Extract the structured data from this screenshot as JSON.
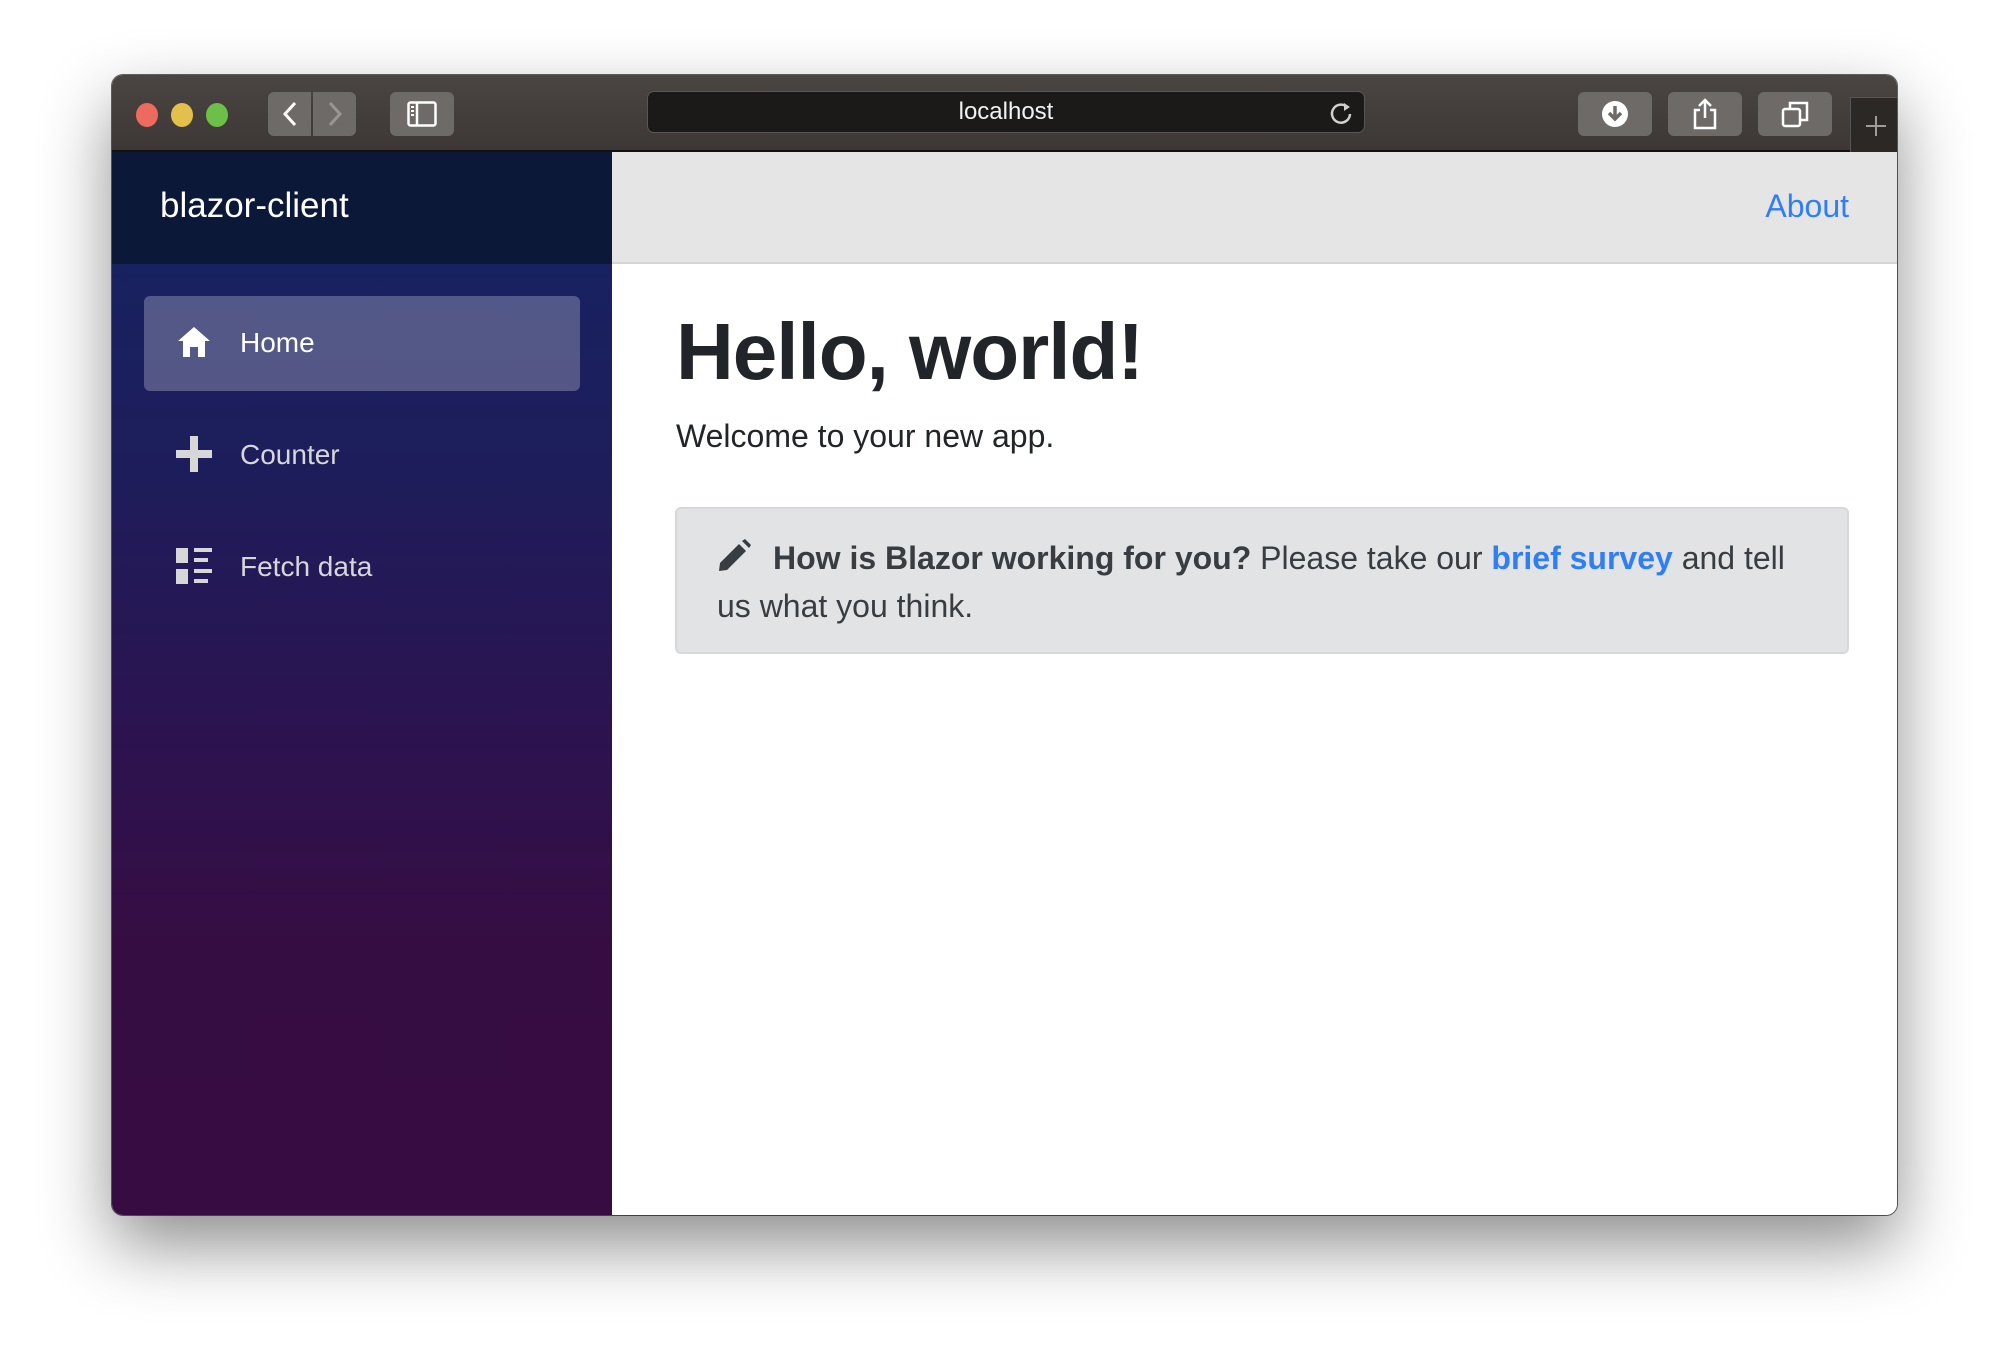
{
  "browser": {
    "url": "localhost",
    "traffic_lights": {
      "close": "#ed6a5e",
      "minimize": "#e2c04b",
      "zoom": "#6cbf47"
    },
    "buttons": [
      "back",
      "forward",
      "sidebar",
      "downloads",
      "share",
      "tabs",
      "new-tab"
    ]
  },
  "sidebar": {
    "brand": "blazor-client",
    "items": [
      {
        "label": "Home",
        "icon": "home-icon",
        "active": true
      },
      {
        "label": "Counter",
        "icon": "plus-icon",
        "active": false
      },
      {
        "label": "Fetch data",
        "icon": "list-icon",
        "active": false
      }
    ]
  },
  "topbar": {
    "about": "About"
  },
  "main": {
    "title": "Hello, world!",
    "welcome": "Welcome to your new app.",
    "alert": {
      "question": "How is Blazor working for you?",
      "text_before": " Please take our ",
      "link": "brief survey",
      "text_after": " and tell us what you think."
    }
  },
  "colors": {
    "link": "#2f7ef6",
    "brand_bg": "#0b1838",
    "topbar_bg": "#e5e5e5",
    "alert_bg": "#e2e3e5"
  }
}
